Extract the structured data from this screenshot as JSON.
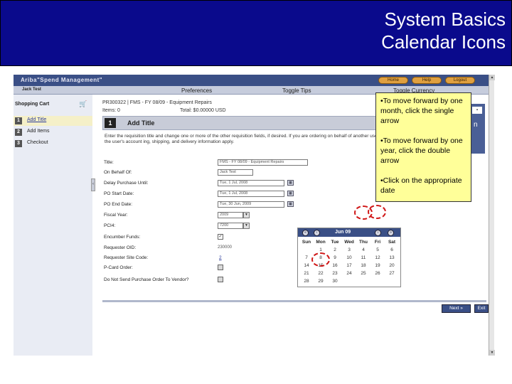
{
  "slide": {
    "title_line1": "System Basics",
    "title_line2": "Calendar Icons"
  },
  "app": {
    "brand": "Ariba\"Spend Management\"",
    "top_buttons": [
      "Home",
      "Help",
      "Logout"
    ],
    "user": "Jack Test",
    "menu": [
      "Preferences",
      "Toggle Tips",
      "Toggle Currency"
    ]
  },
  "nav": {
    "cart_header": "Shopping Cart",
    "steps": [
      {
        "num": "1",
        "label": "Add Title"
      },
      {
        "num": "2",
        "label": "Add Items"
      },
      {
        "num": "3",
        "label": "Checkout"
      }
    ]
  },
  "main": {
    "req_line": "PR300322 | FMS - FY 08/09 - Equipment Repairs",
    "items": "Items: 0",
    "total": "Total: $0.00000 USD",
    "step_num": "1",
    "step_title": "Add Title",
    "instructions": "Enter the requisition title and change one or more of the other requisition fields, if desired. If you are ordering on behalf of another user, the user's account ing, shipping, and delivery information apply.",
    "fields": [
      {
        "label": "Title:",
        "value": "FMS - FY 08/09 - Equipment Repairs"
      },
      {
        "label": "On Behalf Of:",
        "value": "Jack Test"
      },
      {
        "label": "Delay Purchase Until:",
        "value": "Tue, 1 Jul, 2008"
      },
      {
        "label": "PO Start Date:",
        "value": "Tue, 1 Jul, 2008"
      },
      {
        "label": "PO End Date:",
        "value": "Tue, 30 Jun, 2009"
      },
      {
        "label": "Fiscal Year:",
        "value": "2009"
      },
      {
        "label": "PCI4:",
        "value": "7200"
      },
      {
        "label": "Encumber Funds:",
        "value": "✓"
      },
      {
        "label": "Requester OID:",
        "value": "230000"
      },
      {
        "label": "Requester Site Code:",
        "value": "2"
      },
      {
        "label": "P-Card Order:",
        "value": ""
      },
      {
        "label": "Do Not Send Purchase Order To Vendor?",
        "value": ""
      }
    ],
    "next_label": "Next »",
    "exit_label": "Exit"
  },
  "calendar": {
    "month": "Jun 09",
    "prev_year": "«",
    "prev_month": "‹",
    "next_month": "›",
    "next_year": "»",
    "days_of_week": [
      "Sun",
      "Mon",
      "Tue",
      "Wed",
      "Thu",
      "Fri",
      "Sat"
    ],
    "rows": [
      [
        "",
        "1",
        "2",
        "3",
        "4",
        "5",
        "6"
      ],
      [
        "7",
        "8",
        "9",
        "10",
        "11",
        "12",
        "13"
      ],
      [
        "14",
        "15",
        "16",
        "17",
        "18",
        "19",
        "20"
      ],
      [
        "21",
        "22",
        "23",
        "24",
        "25",
        "26",
        "27"
      ],
      [
        "28",
        "29",
        "30",
        "",
        "",
        "",
        ""
      ]
    ]
  },
  "note": {
    "item1": "•To move forward by one month, click the single arrow",
    "item2": "•To move forward by one year, click the double arrow",
    "item3": "•Click on the appropriate date"
  },
  "colors": {
    "slide_header": "#0a0a8c",
    "app_bar": "#3a4f86",
    "note_bg": "#ffff99",
    "highlight_ring": "#d01818"
  }
}
